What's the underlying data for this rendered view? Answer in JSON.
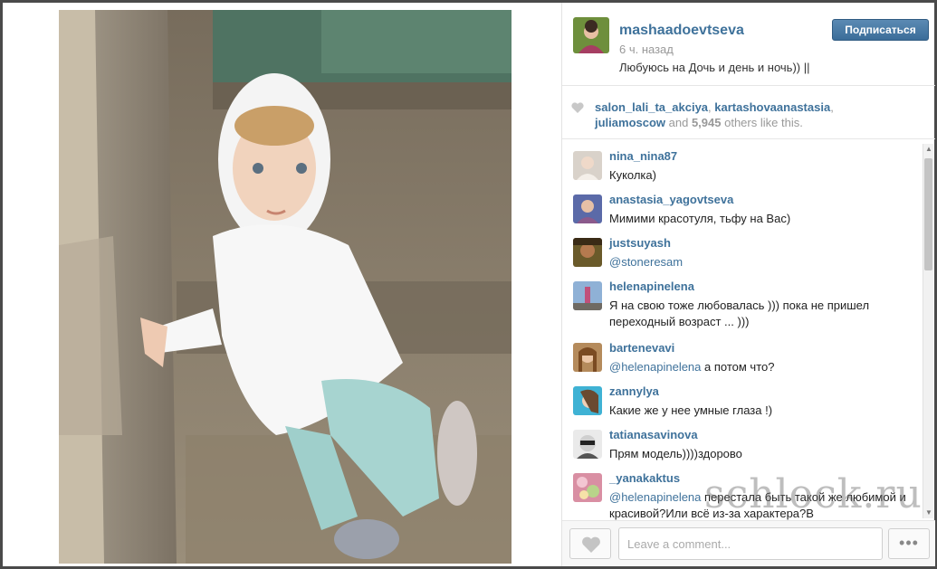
{
  "post": {
    "owner": "mashaadoevtseva",
    "time": "6 ч. назад",
    "caption": "Любуюсь на Дочь и день и ночь)) ||",
    "follow_label": "Подписаться"
  },
  "likes": {
    "user1": "salon_lali_ta_akciya",
    "sep1": ", ",
    "user2": "kartashovaanastasia",
    "sep2": ",",
    "user3": "juliamoscow",
    "and": " and ",
    "count": "5,945",
    "rest": " others like this."
  },
  "comments": [
    {
      "user": "nina_nina87",
      "text": "Куколка)",
      "mention": ""
    },
    {
      "user": "anastasia_yagovtseva",
      "text": "Мимими красотуля, тьфу на Вас)",
      "mention": ""
    },
    {
      "user": "justsuyash",
      "text": "",
      "mention": "@stoneresam"
    },
    {
      "user": "helenapinelena",
      "text": "Я на свою тоже любовалась ))) пока не пришел переходный возраст ... )))",
      "mention": ""
    },
    {
      "user": "bartenevavi",
      "text": " а потом что?",
      "mention": "@helenapinelena"
    },
    {
      "user": "zannylya",
      "text": "Какие же у нее умные глаза !)",
      "mention": ""
    },
    {
      "user": "tatianasavinova",
      "text": "Прям модель))))здорово",
      "mention": ""
    },
    {
      "user": "_yanakaktus",
      "text": " перестала быть такой же любимой и красивой?Или всё из-за характера?В",
      "mention": "@helenapinelena"
    }
  ],
  "footer": {
    "comment_placeholder": "Leave a comment...",
    "more_label": "•••"
  },
  "watermark": "schlock.ru",
  "colors": {
    "link": "#3f729b",
    "follow_button": "#3b6d99",
    "muted": "#999999"
  }
}
